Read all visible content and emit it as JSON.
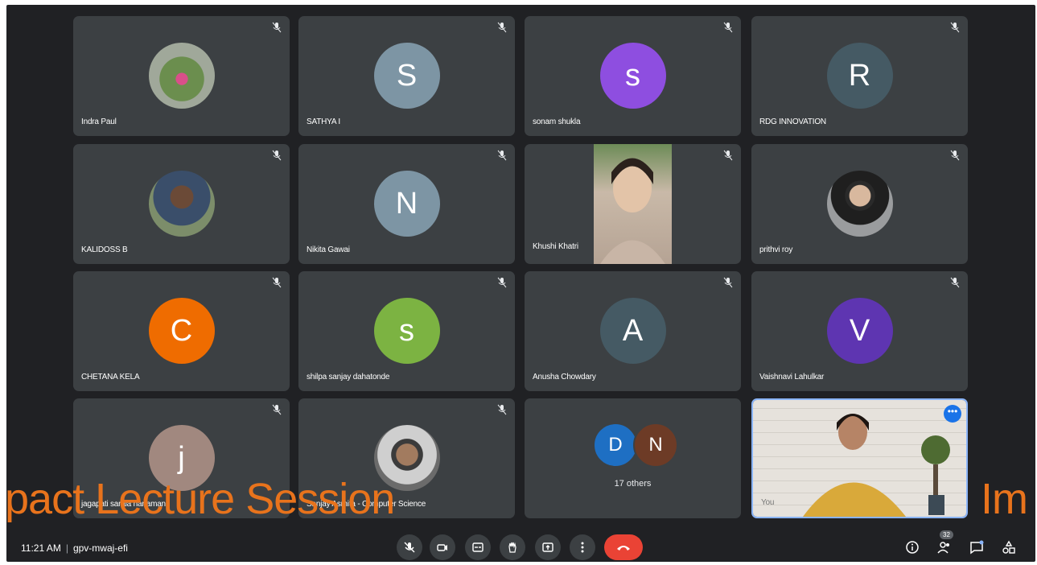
{
  "participants": [
    {
      "name": "Indra Paul",
      "initial": "",
      "color": "#6b7d5a",
      "photo": true
    },
    {
      "name": "SATHYA I",
      "initial": "S",
      "color": "#7d95a4",
      "photo": false
    },
    {
      "name": "sonam shukla",
      "initial": "s",
      "color": "#8e4ee0",
      "photo": false
    },
    {
      "name": "RDG INNOVATION",
      "initial": "R",
      "color": "#455a64",
      "photo": false
    },
    {
      "name": "KALIDOSS B",
      "initial": "",
      "color": "#5d6b55",
      "photo": true
    },
    {
      "name": "Nikita Gawai",
      "initial": "N",
      "color": "#7d95a4",
      "photo": false
    },
    {
      "name": "Khushi Khatri",
      "initial": "",
      "color": "",
      "photo": false,
      "video": true
    },
    {
      "name": "prithvi roy",
      "initial": "",
      "color": "#6a6e72",
      "photo": true
    },
    {
      "name": "CHETANA KELA",
      "initial": "C",
      "color": "#ef6c00",
      "photo": false
    },
    {
      "name": "shilpa sanjay dahatonde",
      "initial": "s",
      "color": "#7cb342",
      "photo": false
    },
    {
      "name": "Anusha Chowdary",
      "initial": "A",
      "color": "#455a64",
      "photo": false
    },
    {
      "name": "Vaishnavi Lahulkar",
      "initial": "V",
      "color": "#5e35b1",
      "photo": false
    },
    {
      "name": "jagapati sarala hanaman",
      "initial": "j",
      "color": "#a1887f",
      "photo": false
    },
    {
      "name": "Sanjay Asmita - Computer Science",
      "initial": "",
      "color": "#8a8a80",
      "photo": true
    }
  ],
  "others_tile": {
    "avatars": [
      {
        "initial": "D",
        "color": "#1e6fc3"
      },
      {
        "initial": "N",
        "color": "#6d3b26"
      }
    ],
    "label": "17 others"
  },
  "presenter_tile": {
    "name": "You",
    "more_label": "•••"
  },
  "caption": {
    "left": "pact Lecture Session",
    "right": "Im"
  },
  "meeting": {
    "time": "11:21 AM",
    "separator": "|",
    "code": "gpv-mwaj-efi"
  },
  "controls": [
    {
      "name": "mic-button",
      "icon": "mic-off-icon"
    },
    {
      "name": "camera-button",
      "icon": "camera-icon"
    },
    {
      "name": "captions-button",
      "icon": "captions-icon"
    },
    {
      "name": "raise-hand-button",
      "icon": "hand-icon"
    },
    {
      "name": "present-button",
      "icon": "present-icon"
    },
    {
      "name": "more-options-button",
      "icon": "more-vert-icon"
    },
    {
      "name": "leave-call-button",
      "icon": "end-call-icon"
    }
  ],
  "right_controls": {
    "people_count": "32"
  }
}
